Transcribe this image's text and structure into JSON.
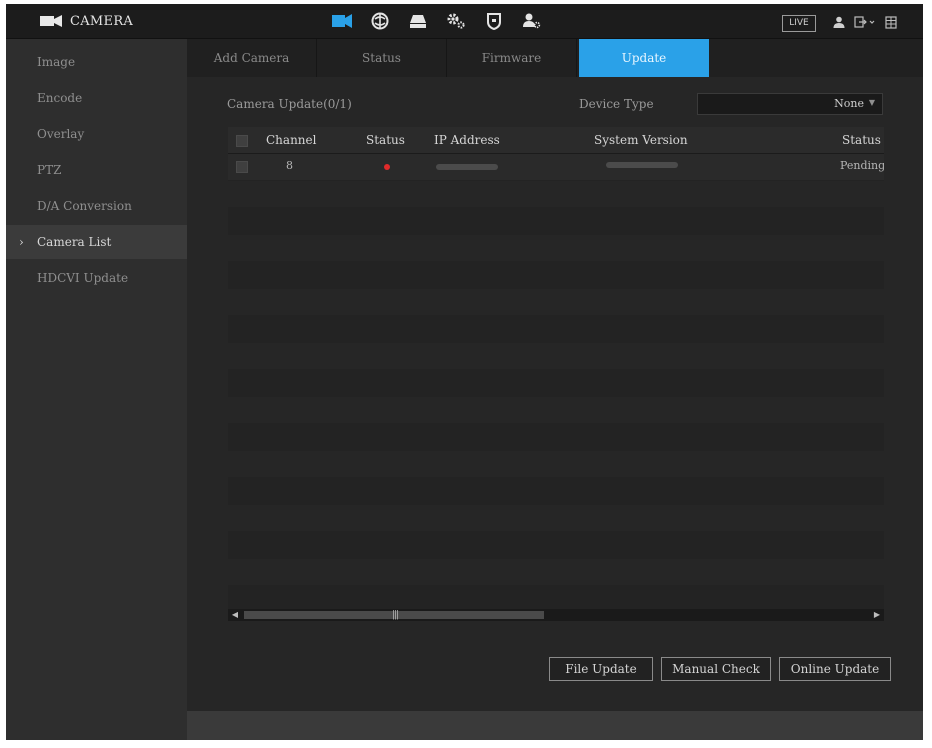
{
  "app": {
    "title": "CAMERA"
  },
  "header": {
    "icons": [
      "camera-icon",
      "network-icon",
      "storage-icon",
      "system-settings-icon",
      "security-icon",
      "account-icon"
    ],
    "live_label": "LIVE",
    "right_icons": [
      "user-icon",
      "logout-icon",
      "grid-icon"
    ]
  },
  "sidebar": {
    "items": [
      {
        "label": "Image"
      },
      {
        "label": "Encode"
      },
      {
        "label": "Overlay"
      },
      {
        "label": "PTZ"
      },
      {
        "label": "D/A Conversion"
      },
      {
        "label": "Camera List",
        "active": true
      },
      {
        "label": "HDCVI Update"
      }
    ]
  },
  "tabs": [
    {
      "label": "Add Camera"
    },
    {
      "label": "Status"
    },
    {
      "label": "Firmware"
    },
    {
      "label": "Update",
      "active": true
    }
  ],
  "main": {
    "camera_update_label": "Camera Update(0/1)",
    "device_type_label": "Device Type",
    "device_type_value": "None"
  },
  "table": {
    "columns": [
      "Channel",
      "Status",
      "IP Address",
      "System Version",
      "Status"
    ],
    "rows": [
      {
        "channel": "8",
        "ip_address": "",
        "system_version": "",
        "update_status": "Pending"
      }
    ]
  },
  "buttons": {
    "file_update": "File Update",
    "manual_check": "Manual Check",
    "online_update": "Online Update"
  },
  "colors": {
    "accent": "#2aa1e8",
    "status_offline": "#e02a2a"
  }
}
